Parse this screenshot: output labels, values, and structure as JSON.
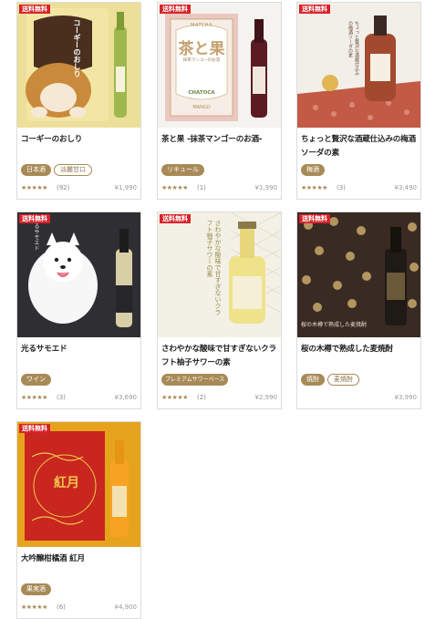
{
  "badge": "送料無料",
  "products": [
    {
      "name": "コーギーのおしり",
      "tags": [
        {
          "label": "日本酒",
          "style": "fill"
        },
        {
          "label": "淡麗甘口",
          "style": "line"
        }
      ],
      "rating_stars": "★★★★★",
      "rating_count": "(92)",
      "price": "¥1,990",
      "label_text": "コーギーのおしり"
    },
    {
      "name": "茶と果 -抹茶マンゴーのお酒-",
      "tags": [
        {
          "label": "リキュール",
          "style": "fill"
        }
      ],
      "rating_stars": "★★★★★",
      "rating_count": "(1)",
      "price": "¥1,990",
      "label_kanji": "茶と果",
      "label_top": "MATCHA",
      "label_sub": "抹茶マンゴーのお酒",
      "label_mid": "CHATOCA",
      "label_bottom": "MANGO"
    },
    {
      "name": "ちょっと贅沢な酒蔵仕込みの梅酒ソーダの素",
      "tags": [
        {
          "label": "梅酒",
          "style": "fill"
        }
      ],
      "rating_stars": "★★★★★",
      "rating_count": "(3)",
      "price": "¥3,490",
      "label_text": "ちょっと贅沢な酒蔵仕込みの梅酒ソーダの素"
    },
    {
      "name": "光るサモエド",
      "tags": [
        {
          "label": "ワイン",
          "style": "fill"
        }
      ],
      "rating_stars": "★★★★★",
      "rating_count": "(3)",
      "price": "¥3,690",
      "label_text": "光るサモエド"
    },
    {
      "name": "さわやかな酸味で甘すぎないクラフト柚子サワーの素",
      "tags": [
        {
          "label": "プレミアムサワーベース",
          "style": "fill"
        }
      ],
      "rating_stars": "★★★★★",
      "rating_count": "(2)",
      "price": "¥2,990",
      "label_text": "さわやかな酸味で甘すぎないクラフト柚子サワーの素"
    },
    {
      "name": "桜の木樽で熟成した麦焼酎",
      "tags": [
        {
          "label": "焼酎",
          "style": "fill"
        },
        {
          "label": "麦焼酎",
          "style": "line"
        }
      ],
      "rating_stars": "",
      "rating_count": "",
      "price": "¥3,990",
      "label_text": "桜の木樽で熟成した麦焼酎"
    },
    {
      "name": "大吟醸柑橘酒 紅月",
      "tags": [
        {
          "label": "果実酒",
          "style": "fill"
        }
      ],
      "rating_stars": "★★★★★",
      "rating_count": "(6)",
      "price": "¥4,900",
      "label_kanji": "紅月"
    }
  ],
  "colors": {
    "ribbon": "#d8222a",
    "tag": "#a88a57",
    "star": "#a88a57"
  }
}
